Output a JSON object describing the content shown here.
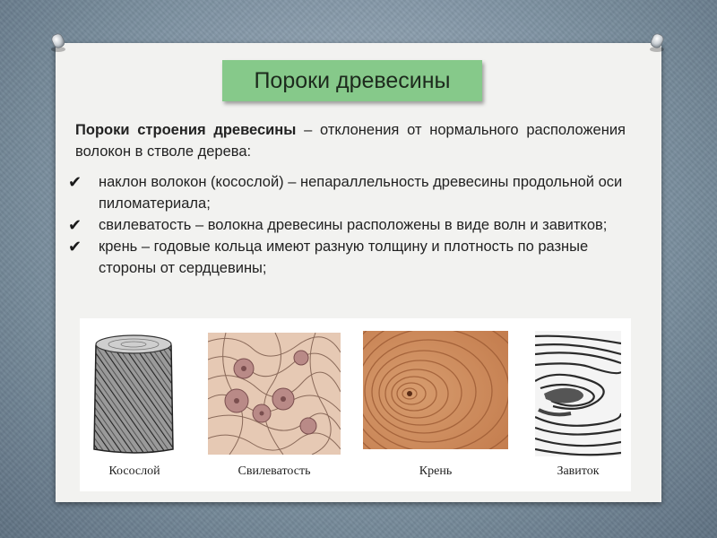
{
  "title": "Пороки древесины",
  "intro": {
    "term": "Пороки строения древесины",
    "definition": " – отклонения от нормального расположения волокон в стволе дерева:"
  },
  "bullets": [
    "наклон волокон (косослой) – непараллельность древесины продольной оси пиломатериала;",
    "свилеватость – волокна древесины расположены в виде волн и завитков;",
    "крень – годовые кольца имеют разную толщину и плотность по разные стороны от сердцевины;"
  ],
  "bullet_icon": "check-mark-icon",
  "figures": [
    {
      "caption": "Косослой",
      "icon": "cross-grain-log-image"
    },
    {
      "caption": "Свилеватость",
      "icon": "wavy-grain-image"
    },
    {
      "caption": "Крень",
      "icon": "compression-wood-rings-image"
    },
    {
      "caption": "Завиток",
      "icon": "curl-grain-image"
    }
  ],
  "colors": {
    "title_background": "#86c98a",
    "board": "#f2f2f0",
    "background": "#8799a8"
  }
}
